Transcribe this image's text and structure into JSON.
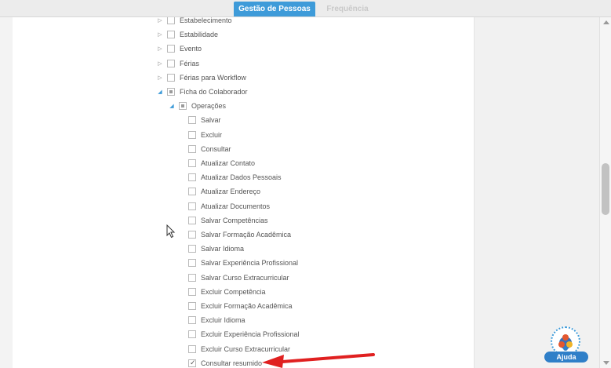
{
  "tabs": [
    {
      "label": "Gestão de Pessoas",
      "active": true
    },
    {
      "label": "Frequência",
      "active": false
    }
  ],
  "tree": [
    {
      "label": "Estabelecimento",
      "level": 0,
      "expander": "closed",
      "state": "unchecked"
    },
    {
      "label": "Estabilidade",
      "level": 0,
      "expander": "closed",
      "state": "unchecked"
    },
    {
      "label": "Evento",
      "level": 0,
      "expander": "closed",
      "state": "unchecked"
    },
    {
      "label": "Férias",
      "level": 0,
      "expander": "closed",
      "state": "unchecked"
    },
    {
      "label": "Férias para Workflow",
      "level": 0,
      "expander": "closed",
      "state": "unchecked"
    },
    {
      "label": "Ficha do Colaborador",
      "level": 0,
      "expander": "open",
      "state": "partial"
    },
    {
      "label": "Operações",
      "level": 1,
      "expander": "open",
      "state": "partial"
    },
    {
      "label": "Salvar",
      "level": 2,
      "expander": "none",
      "state": "unchecked"
    },
    {
      "label": "Excluir",
      "level": 2,
      "expander": "none",
      "state": "unchecked"
    },
    {
      "label": "Consultar",
      "level": 2,
      "expander": "none",
      "state": "unchecked"
    },
    {
      "label": "Atualizar Contato",
      "level": 2,
      "expander": "none",
      "state": "unchecked"
    },
    {
      "label": "Atualizar Dados Pessoais",
      "level": 2,
      "expander": "none",
      "state": "unchecked"
    },
    {
      "label": "Atualizar Endereço",
      "level": 2,
      "expander": "none",
      "state": "unchecked"
    },
    {
      "label": "Atualizar Documentos",
      "level": 2,
      "expander": "none",
      "state": "unchecked"
    },
    {
      "label": "Salvar Competências",
      "level": 2,
      "expander": "none",
      "state": "unchecked"
    },
    {
      "label": "Salvar Formação Acadêmica",
      "level": 2,
      "expander": "none",
      "state": "unchecked"
    },
    {
      "label": "Salvar Idioma",
      "level": 2,
      "expander": "none",
      "state": "unchecked"
    },
    {
      "label": "Salvar Experiência Profissional",
      "level": 2,
      "expander": "none",
      "state": "unchecked"
    },
    {
      "label": "Salvar Curso Extracurricular",
      "level": 2,
      "expander": "none",
      "state": "unchecked"
    },
    {
      "label": "Excluir Competência",
      "level": 2,
      "expander": "none",
      "state": "unchecked"
    },
    {
      "label": "Excluir Formação Acadêmica",
      "level": 2,
      "expander": "none",
      "state": "unchecked"
    },
    {
      "label": "Excluir Idioma",
      "level": 2,
      "expander": "none",
      "state": "unchecked"
    },
    {
      "label": "Excluir Experiência Profissional",
      "level": 2,
      "expander": "none",
      "state": "unchecked"
    },
    {
      "label": "Excluir Curso Extracurricular",
      "level": 2,
      "expander": "none",
      "state": "unchecked"
    },
    {
      "label": "Consultar resumido",
      "level": 2,
      "expander": "none",
      "state": "checked"
    }
  ],
  "help": {
    "label": "Ajuda"
  },
  "colors": {
    "accent": "#3e9bd9",
    "annotation_arrow": "#e02020"
  }
}
